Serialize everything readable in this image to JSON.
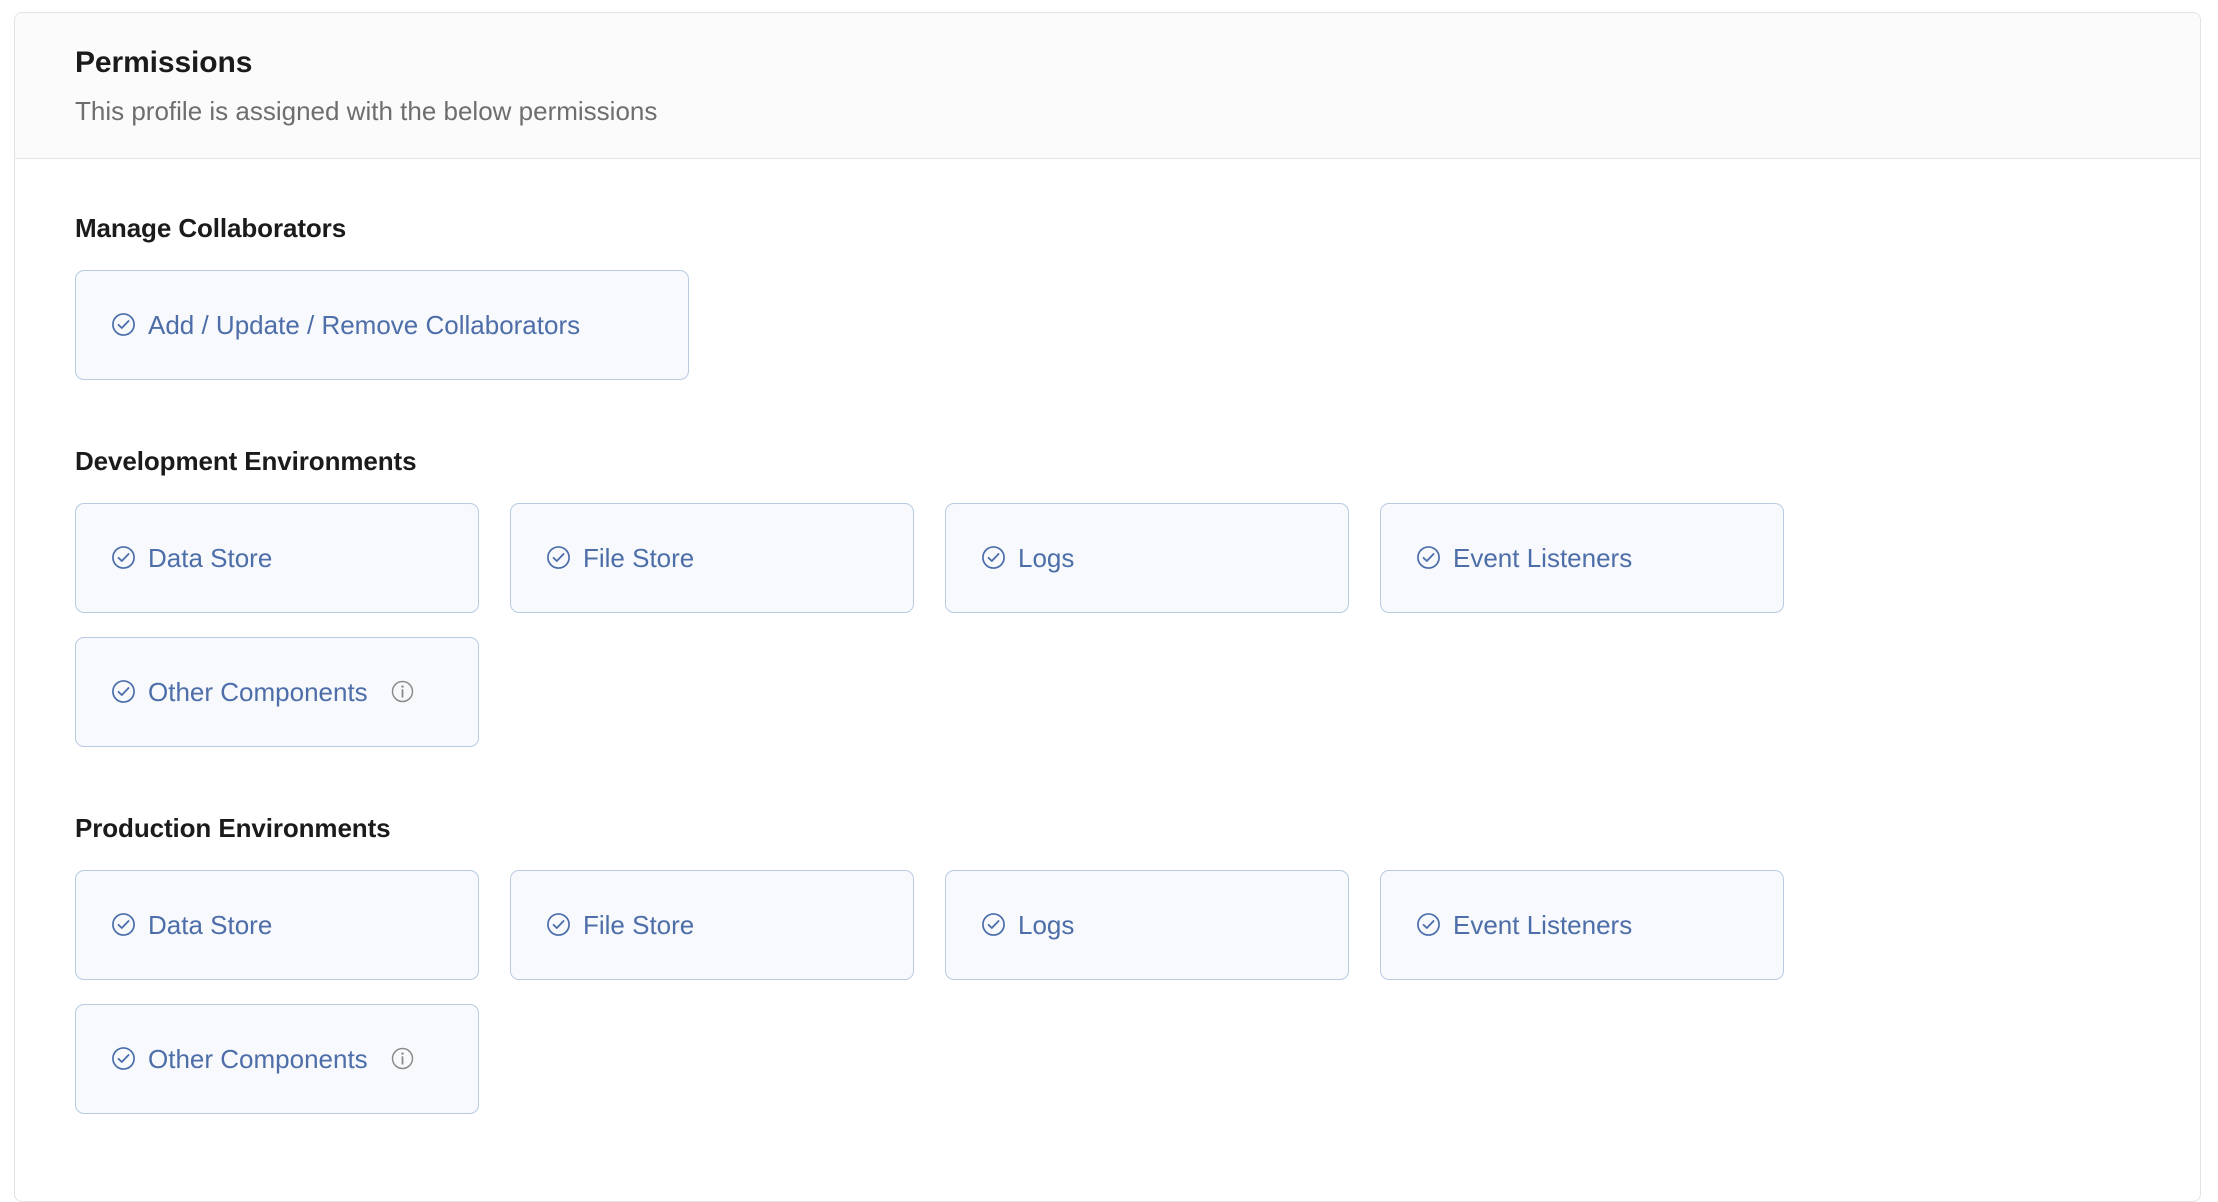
{
  "panel": {
    "title": "Permissions",
    "subtitle": "This profile is assigned with the below permissions"
  },
  "colors": {
    "chip_text": "#4d6ea8",
    "chip_border": "#b9cbe1",
    "chip_background": "#f7f9fd",
    "heading_text": "#1b1b1b",
    "subtitle_text": "#6e6e6e",
    "info_icon": "#8a8a8a",
    "panel_border": "#e3e3e3",
    "header_background": "#fbfbfb"
  },
  "sections": [
    {
      "title": "Manage Collaborators",
      "chips": [
        {
          "label": "Add / Update / Remove Collaborators",
          "check_icon": "circle-check-icon",
          "info_icon": null,
          "wide": true,
          "checked": true
        }
      ]
    },
    {
      "title": "Development Environments",
      "chips": [
        {
          "label": "Data Store",
          "check_icon": "circle-check-icon",
          "info_icon": null,
          "wide": false,
          "checked": true
        },
        {
          "label": "File Store",
          "check_icon": "circle-check-icon",
          "info_icon": null,
          "wide": false,
          "checked": true
        },
        {
          "label": "Logs",
          "check_icon": "circle-check-icon",
          "info_icon": null,
          "wide": false,
          "checked": true
        },
        {
          "label": "Event Listeners",
          "check_icon": "circle-check-icon",
          "info_icon": null,
          "wide": false,
          "checked": true
        },
        {
          "label": "Other Components",
          "check_icon": "circle-check-icon",
          "info_icon": "info-icon",
          "wide": false,
          "checked": true
        }
      ]
    },
    {
      "title": "Production Environments",
      "chips": [
        {
          "label": "Data Store",
          "check_icon": "circle-check-icon",
          "info_icon": null,
          "wide": false,
          "checked": true
        },
        {
          "label": "File Store",
          "check_icon": "circle-check-icon",
          "info_icon": null,
          "wide": false,
          "checked": true
        },
        {
          "label": "Logs",
          "check_icon": "circle-check-icon",
          "info_icon": null,
          "wide": false,
          "checked": true
        },
        {
          "label": "Event Listeners",
          "check_icon": "circle-check-icon",
          "info_icon": null,
          "wide": false,
          "checked": true
        },
        {
          "label": "Other Components",
          "check_icon": "circle-check-icon",
          "info_icon": "info-icon",
          "wide": false,
          "checked": true
        }
      ]
    }
  ]
}
